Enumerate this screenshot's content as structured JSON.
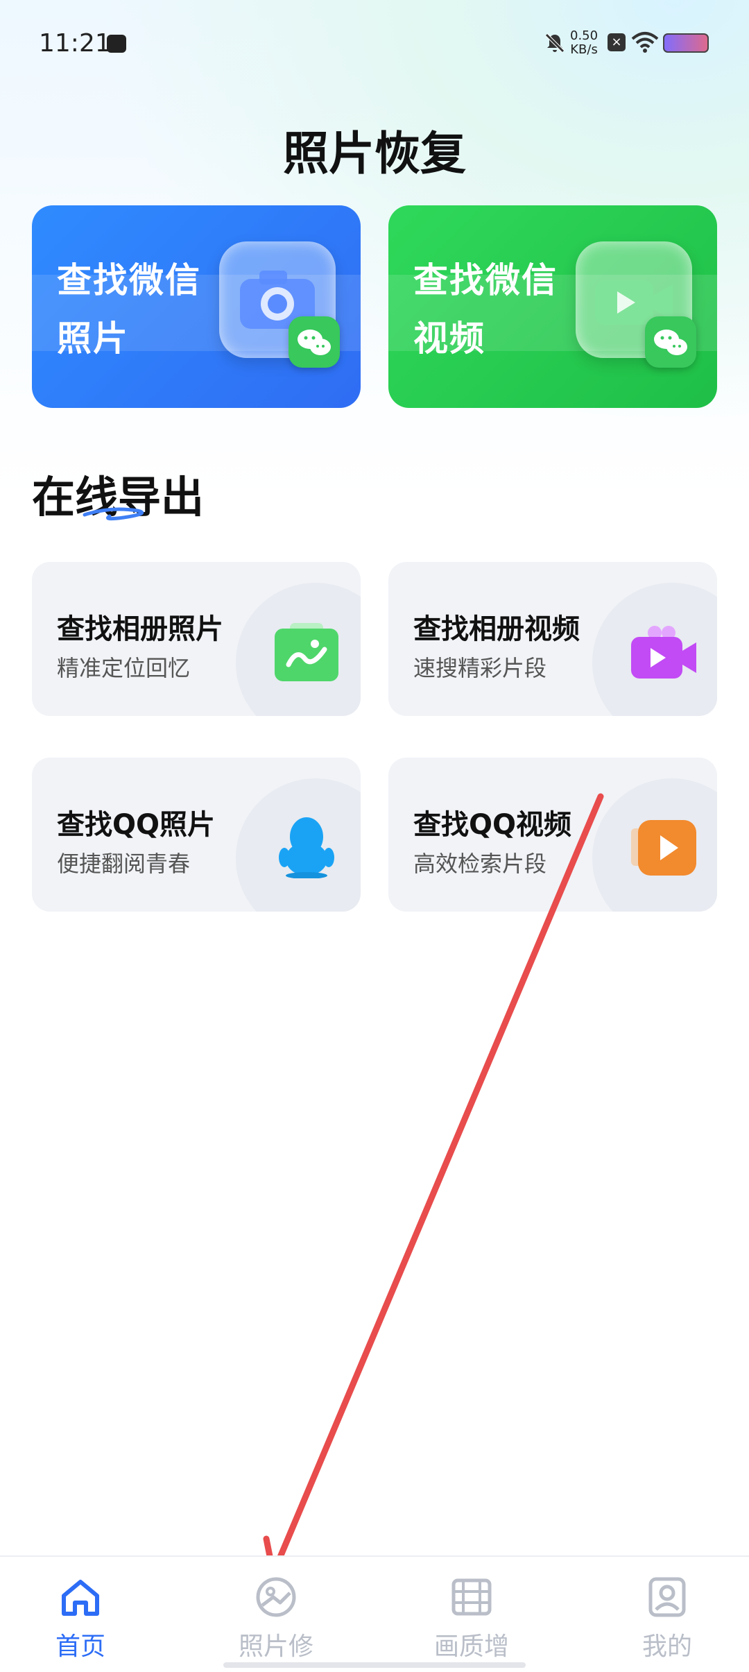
{
  "status_bar": {
    "time": "11:21",
    "net_speed_value": "0.50",
    "net_speed_unit": "KB/s"
  },
  "page_title": "照片恢复",
  "feature_cards": [
    {
      "line1": "查找微信",
      "line2": "照片",
      "icon": "camera-icon"
    },
    {
      "line1": "查找微信",
      "line2": "视频",
      "icon": "video-icon"
    }
  ],
  "section": {
    "title": "在线导出"
  },
  "export_cards": [
    {
      "title": "查找相册照片",
      "subtitle": "精准定位回忆",
      "icon": "album-photo-icon",
      "color": "#4fd66a"
    },
    {
      "title": "查找相册视频",
      "subtitle": "速搜精彩片段",
      "icon": "album-video-icon",
      "color": "#c24bf5"
    },
    {
      "title": "查找QQ照片",
      "subtitle": "便捷翻阅青春",
      "icon": "qq-penguin-icon",
      "color": "#1aa3f5"
    },
    {
      "title": "查找QQ视频",
      "subtitle": "高效检索片段",
      "icon": "qq-video-icon",
      "color": "#f28a2e"
    }
  ],
  "tabbar": {
    "tabs": [
      {
        "label": "首页",
        "icon": "home-icon",
        "active": true
      },
      {
        "label": "照片修",
        "icon": "image-repair-icon",
        "active": false
      },
      {
        "label": "画质增",
        "icon": "film-icon",
        "active": false
      },
      {
        "label": "我的",
        "icon": "profile-icon",
        "active": false
      }
    ]
  },
  "colors": {
    "accent": "#2d6df6",
    "annotation_arrow": "#e84c4c"
  }
}
